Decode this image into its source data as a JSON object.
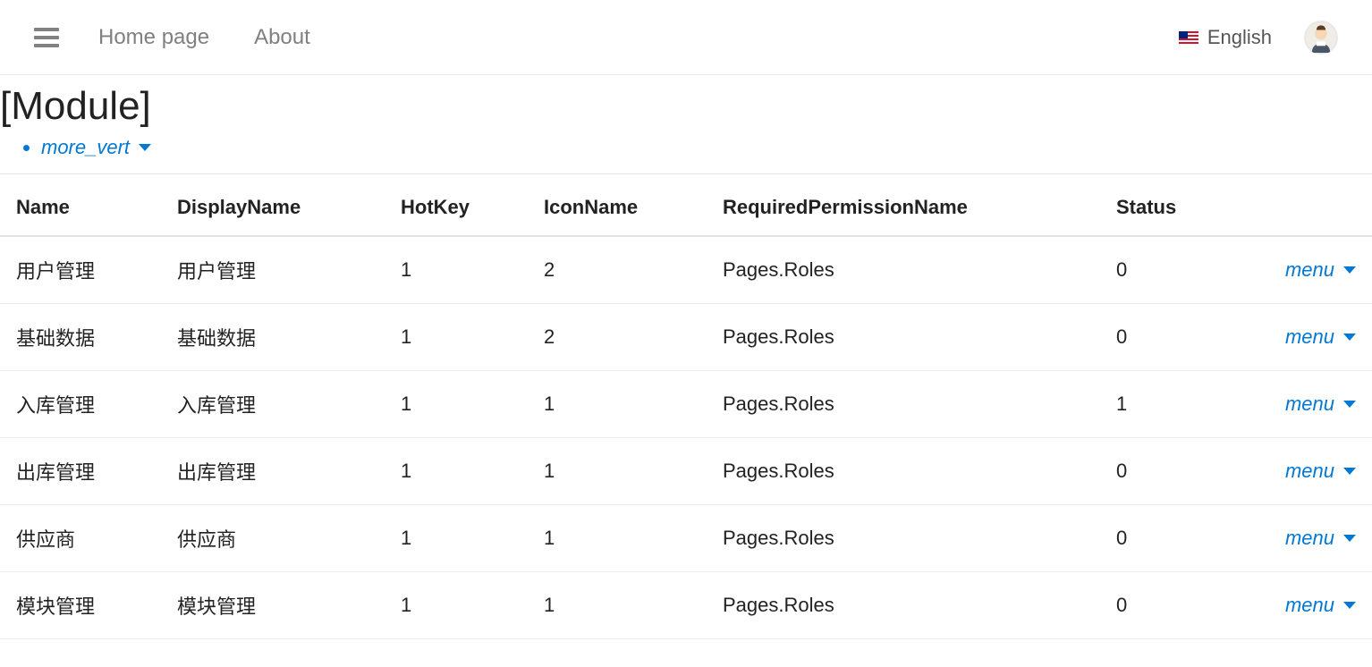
{
  "nav": {
    "home": "Home page",
    "about": "About",
    "language": "English"
  },
  "page": {
    "title": "[Module]"
  },
  "actions": {
    "more": "more_vert"
  },
  "table": {
    "headers": {
      "name": "Name",
      "displayName": "DisplayName",
      "hotKey": "HotKey",
      "iconName": "IconName",
      "permission": "RequiredPermissionName",
      "status": "Status"
    },
    "menu_label": "menu",
    "rows": [
      {
        "name": "用户管理",
        "displayName": "用户管理",
        "hotKey": "1",
        "iconName": "2",
        "permission": "Pages.Roles",
        "status": "0"
      },
      {
        "name": "基础数据",
        "displayName": "基础数据",
        "hotKey": "1",
        "iconName": "2",
        "permission": "Pages.Roles",
        "status": "0"
      },
      {
        "name": "入库管理",
        "displayName": "入库管理",
        "hotKey": "1",
        "iconName": "1",
        "permission": "Pages.Roles",
        "status": "1"
      },
      {
        "name": "出库管理",
        "displayName": "出库管理",
        "hotKey": "1",
        "iconName": "1",
        "permission": "Pages.Roles",
        "status": "0"
      },
      {
        "name": "供应商",
        "displayName": "供应商",
        "hotKey": "1",
        "iconName": "1",
        "permission": "Pages.Roles",
        "status": "0"
      },
      {
        "name": "模块管理",
        "displayName": "模块管理",
        "hotKey": "1",
        "iconName": "1",
        "permission": "Pages.Roles",
        "status": "0"
      }
    ]
  }
}
